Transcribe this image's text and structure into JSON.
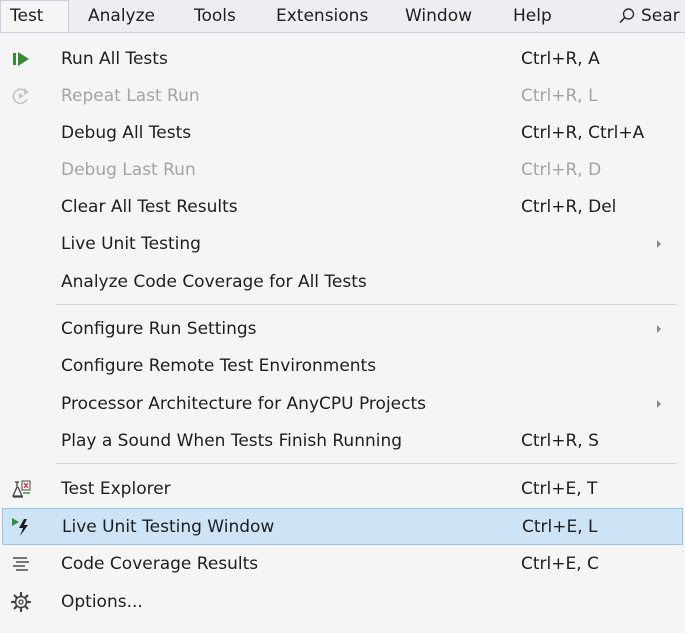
{
  "menubar": {
    "items": [
      "Test",
      "Analyze",
      "Tools",
      "Extensions",
      "Window",
      "Help"
    ],
    "search_label": "Sear"
  },
  "menu": {
    "items": [
      {
        "label": "Run All Tests",
        "shortcut": "Ctrl+R, A",
        "icon": "run-all-tests-icon",
        "enabled": true
      },
      {
        "label": "Repeat Last Run",
        "shortcut": "Ctrl+R, L",
        "icon": "repeat-icon",
        "enabled": false
      },
      {
        "label": "Debug All Tests",
        "shortcut": "Ctrl+R, Ctrl+A",
        "enabled": true
      },
      {
        "label": "Debug Last Run",
        "shortcut": "Ctrl+R, D",
        "enabled": false
      },
      {
        "label": "Clear All Test Results",
        "shortcut": "Ctrl+R, Del",
        "enabled": true
      },
      {
        "label": "Live Unit Testing",
        "submenu": true,
        "enabled": true
      },
      {
        "label": "Analyze Code Coverage for All Tests",
        "enabled": true
      },
      {
        "label": "Configure Run Settings",
        "submenu": true,
        "enabled": true
      },
      {
        "label": "Configure Remote Test Environments",
        "enabled": true
      },
      {
        "label": "Processor Architecture for AnyCPU Projects",
        "submenu": true,
        "enabled": true
      },
      {
        "label": "Play a Sound When Tests Finish Running",
        "shortcut": "Ctrl+R, S",
        "enabled": true
      },
      {
        "label": "Test Explorer",
        "shortcut": "Ctrl+E, T",
        "icon": "test-explorer-icon",
        "enabled": true
      },
      {
        "label": "Live Unit Testing Window",
        "shortcut": "Ctrl+E, L",
        "icon": "live-unit-testing-icon",
        "enabled": true,
        "highlighted": true
      },
      {
        "label": "Code Coverage Results",
        "shortcut": "Ctrl+E, C",
        "icon": "code-coverage-icon",
        "enabled": true
      },
      {
        "label": "Options...",
        "icon": "gear-icon",
        "enabled": true
      }
    ]
  },
  "colors": {
    "background": "#f5f5f5",
    "highlight": "#cde4f7",
    "highlight_border": "#9bc3e6",
    "disabled_text": "#a2a4a5",
    "run_green": "#388a34"
  }
}
